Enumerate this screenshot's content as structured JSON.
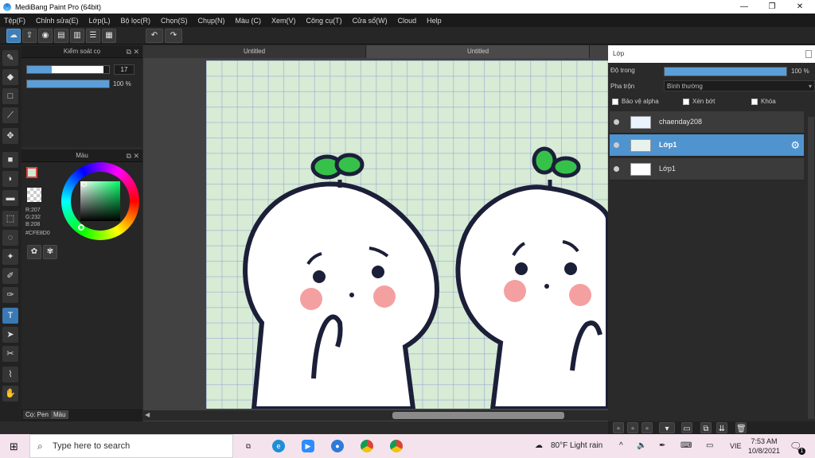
{
  "app": {
    "title": "MediBang Paint Pro (64bit)"
  },
  "window_controls": {
    "minimize": "—",
    "maximize": "❐",
    "close": "✕"
  },
  "menu": [
    "Tệp(F)",
    "Chỉnh sửa(E)",
    "Lớp(L)",
    "Bộ lọc(R)",
    "Chọn(S)",
    "Chụp(N)",
    "Màu (C)",
    "Xem(V)",
    "Công cụ(T)",
    "Cửa sổ(W)",
    "Cloud",
    "Help"
  ],
  "toolbar": {
    "undo": "↶",
    "redo": "↷"
  },
  "brush_panel": {
    "title": "Kiểm soát cọ",
    "size_value": "17",
    "opacity_value": "100 %",
    "size_fraction": 0.3,
    "opacity_fraction": 1.0
  },
  "color_panel": {
    "title": "Màu",
    "r": "R:207",
    "g": "G:232",
    "b": "B:208",
    "hex": "#CFE8D0",
    "current_color": "#CFE8D0",
    "hue_color": "#00ff66"
  },
  "bottom_tabs": [
    "Cọ: Pen",
    "Màu"
  ],
  "document": {
    "tabs": [
      "Untitled",
      "Untitled"
    ]
  },
  "layer_panel": {
    "title": "Lớp",
    "opacity_label": "Độ trong",
    "opacity_value": "100 %",
    "opacity_fraction": 1.0,
    "blend_label": "Pha trộn",
    "blend_value": "Bình thường",
    "protect_alpha": "Bảo vệ alpha",
    "clipping": "Xén bớt",
    "lock": "Khóa",
    "layers": [
      {
        "name": "chaenday208",
        "selected": false
      },
      {
        "name": "Lớp1",
        "selected": true
      },
      {
        "name": "Lớp1",
        "selected": false
      }
    ]
  },
  "taskbar": {
    "search_placeholder": "Type here to search",
    "weather": "80°F  Light rain",
    "language": "VIE",
    "time": "7:53 AM",
    "date": "10/8/2021",
    "notification_count": "1"
  },
  "colors": {
    "accent": "#4f93cf",
    "canvas_bg": "#d7ebd5",
    "leaf": "#36c24a",
    "cheek": "#f5a0a0",
    "outline": "#1b1f38"
  }
}
